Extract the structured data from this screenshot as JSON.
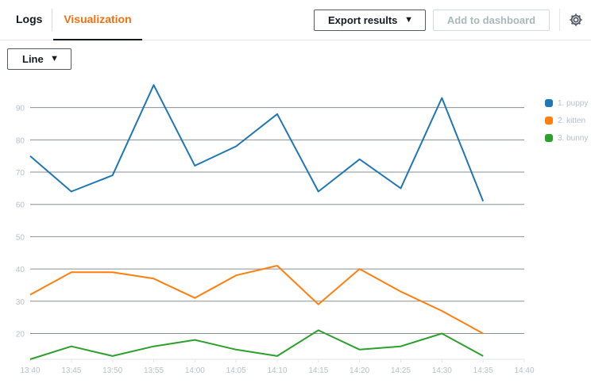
{
  "tabs": [
    {
      "label": "Logs"
    },
    {
      "label": "Visualization"
    }
  ],
  "toolbar": {
    "export_label": "Export results",
    "dashboard_label": "Add to dashboard",
    "caret": "▼"
  },
  "chart_selector": {
    "selected": "Line"
  },
  "legend": [
    {
      "label": "1. puppy",
      "color": "#1f77b4"
    },
    {
      "label": "2. kitten",
      "color": "#ff7f0e"
    },
    {
      "label": "3. bunny",
      "color": "#2ca02c"
    }
  ],
  "chart_data": {
    "type": "line",
    "x": [
      "13:40",
      "13:45",
      "13:50",
      "13:55",
      "14:00",
      "14:05",
      "14:10",
      "14:15",
      "14:20",
      "14:25",
      "14:30",
      "14:35"
    ],
    "x_ticks": [
      "13:40",
      "13:45",
      "13:50",
      "13:55",
      "14:00",
      "14:05",
      "14:10",
      "14:15",
      "14:20",
      "14:25",
      "14:30",
      "14:35",
      "14:40"
    ],
    "y_ticks": [
      20,
      30,
      40,
      50,
      60,
      70,
      80,
      90
    ],
    "ylim": [
      12,
      100
    ],
    "grid": true,
    "legend_position": "right",
    "series": [
      {
        "name": "1. puppy",
        "color": "#1f77b4",
        "values": [
          75,
          64,
          69,
          97,
          72,
          78,
          88,
          64,
          74,
          65,
          93,
          61
        ]
      },
      {
        "name": "2. kitten",
        "color": "#ff7f0e",
        "values": [
          32,
          39,
          39,
          37,
          31,
          38,
          41,
          29,
          40,
          33,
          27,
          20
        ]
      },
      {
        "name": "3. bunny",
        "color": "#2ca02c",
        "values": [
          12,
          16,
          13,
          16,
          18,
          15,
          13,
          21,
          15,
          16,
          20,
          13
        ]
      }
    ]
  }
}
